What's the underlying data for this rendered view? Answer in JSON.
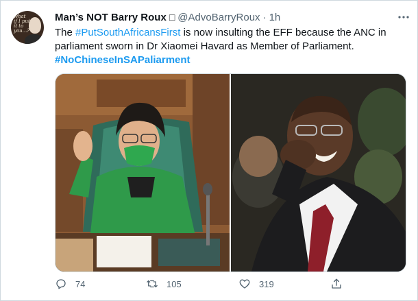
{
  "tweet": {
    "author_name": "Man’s NOT Barry Roux",
    "verified_glyph": "□",
    "handle": "@AdvoBarryRoux",
    "separator": "·",
    "time": "1h",
    "more_icon": "more-horizontal-icon",
    "avatar_text": "what if I put it to you...?",
    "text_prefix": "The ",
    "hashtag_1": "#PutSouthAfricansFirst",
    "text_suffix": " is now insulting the EFF because the ANC in parliament sworn in Dr Xiaomei Havard as Member of Parliament.",
    "hashtag_2": "#NoChineseInSAPaliarment"
  },
  "media": {
    "photo_left": "woman-taking-oath-in-parliament",
    "photo_right": "man-laughing-in-suit"
  },
  "actions": {
    "reply_count": "74",
    "retweet_count": "105",
    "like_count": "319",
    "share_icon": "share-icon"
  },
  "colors": {
    "accent": "#1d9bf0",
    "secondary_text": "#536471",
    "border": "#cfd9de"
  }
}
